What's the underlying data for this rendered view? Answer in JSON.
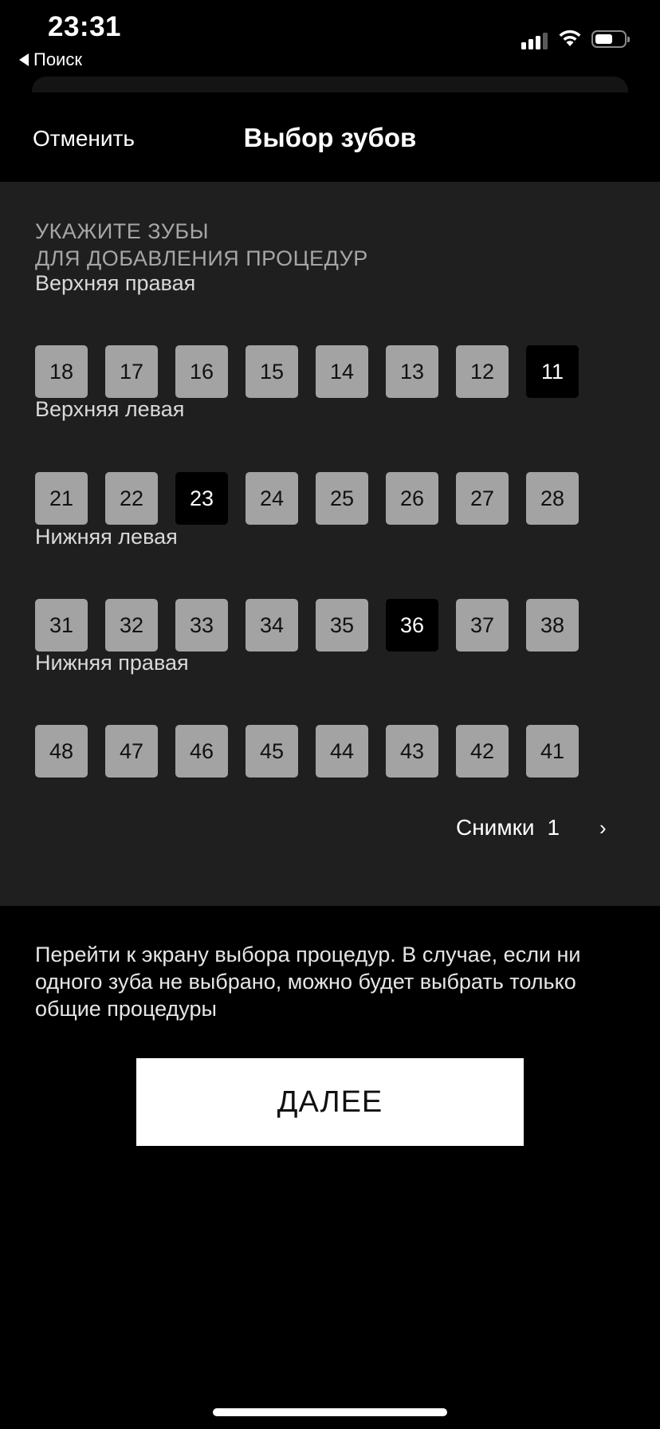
{
  "status_bar": {
    "time": "23:31",
    "back_app": "Поиск",
    "icons": [
      "signal-icon",
      "wifi-icon",
      "battery-icon"
    ]
  },
  "nav": {
    "cancel_label": "Отменить",
    "title": "Выбор зубов"
  },
  "instruction": {
    "line1": "УКАЖИТЕ ЗУБЫ",
    "line2": "ДЛЯ ДОБАВЛЕНИЯ ПРОЦЕДУР"
  },
  "groups": [
    {
      "label": "Верхняя правая",
      "teeth": [
        {
          "n": "18",
          "selected": false
        },
        {
          "n": "17",
          "selected": false
        },
        {
          "n": "16",
          "selected": false
        },
        {
          "n": "15",
          "selected": false
        },
        {
          "n": "14",
          "selected": false
        },
        {
          "n": "13",
          "selected": false
        },
        {
          "n": "12",
          "selected": false
        },
        {
          "n": "11",
          "selected": true
        }
      ]
    },
    {
      "label": "Верхняя левая",
      "teeth": [
        {
          "n": "21",
          "selected": false
        },
        {
          "n": "22",
          "selected": false
        },
        {
          "n": "23",
          "selected": true
        },
        {
          "n": "24",
          "selected": false
        },
        {
          "n": "25",
          "selected": false
        },
        {
          "n": "26",
          "selected": false
        },
        {
          "n": "27",
          "selected": false
        },
        {
          "n": "28",
          "selected": false
        }
      ]
    },
    {
      "label": "Нижняя левая",
      "teeth": [
        {
          "n": "31",
          "selected": false
        },
        {
          "n": "32",
          "selected": false
        },
        {
          "n": "33",
          "selected": false
        },
        {
          "n": "34",
          "selected": false
        },
        {
          "n": "35",
          "selected": false
        },
        {
          "n": "36",
          "selected": true
        },
        {
          "n": "37",
          "selected": false
        },
        {
          "n": "38",
          "selected": false
        }
      ]
    },
    {
      "label": "Нижняя правая",
      "teeth": [
        {
          "n": "48",
          "selected": false
        },
        {
          "n": "47",
          "selected": false
        },
        {
          "n": "46",
          "selected": false
        },
        {
          "n": "45",
          "selected": false
        },
        {
          "n": "44",
          "selected": false
        },
        {
          "n": "43",
          "selected": false
        },
        {
          "n": "42",
          "selected": false
        },
        {
          "n": "41",
          "selected": false
        }
      ]
    }
  ],
  "photos": {
    "label": "Снимки",
    "count": "1",
    "chevron": "›"
  },
  "hint": "Перейти к экрану выбора процедур. В случае, если ни одного зуба не выбрано, можно будет выбрать только общие процедуры",
  "next_label": "ДАЛЕЕ",
  "colors": {
    "background": "#000000",
    "panel": "#1f1f1f",
    "tooth_default": "#a3a3a3",
    "tooth_selected": "#000000",
    "button": "#ffffff"
  }
}
